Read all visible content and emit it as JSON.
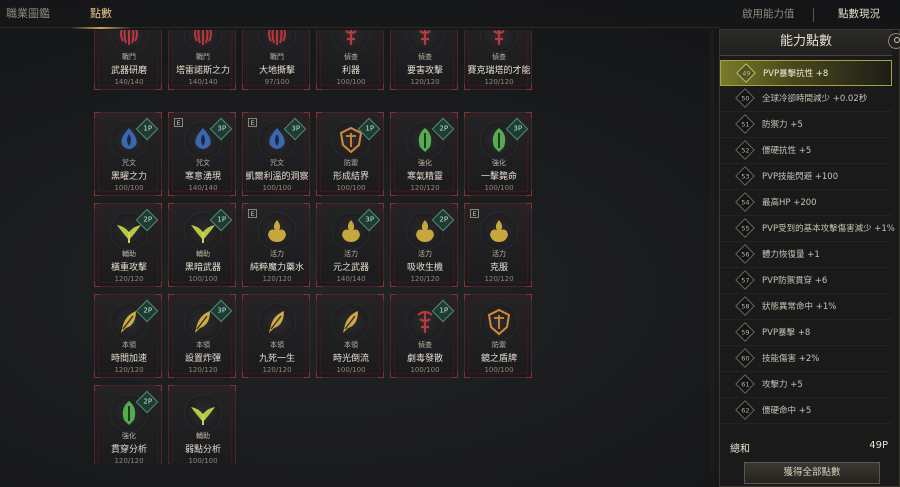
{
  "tabs": {
    "left": [
      "職業圖鑑",
      "點數"
    ],
    "right": [
      "啟用能力值",
      "點數現況"
    ]
  },
  "cards": [
    {
      "cat": "戰鬥",
      "name": "武器研磨",
      "prog": "140/140",
      "icon": "rune-combat-icon",
      "color": "#c0343b",
      "badge": "",
      "e": false
    },
    {
      "cat": "戰鬥",
      "name": "塔雷諾斯之力",
      "prog": "140/140",
      "icon": "rune-combat-icon",
      "color": "#c0343b",
      "badge": "",
      "e": false
    },
    {
      "cat": "戰鬥",
      "name": "大地撕擊",
      "prog": "97/100",
      "icon": "rune-combat-icon",
      "color": "#c0343b",
      "badge": "",
      "e": false
    },
    {
      "cat": "偵查",
      "name": "利器",
      "prog": "100/100",
      "icon": "rune-scout-icon",
      "color": "#b83a3e",
      "badge": "",
      "e": false
    },
    {
      "cat": "偵查",
      "name": "要害攻擊",
      "prog": "120/120",
      "icon": "rune-scout-icon",
      "color": "#b83a3e",
      "badge": "",
      "e": false
    },
    {
      "cat": "偵查",
      "name": "賽克瑞塔的才能",
      "prog": "120/120",
      "icon": "rune-scout-icon",
      "color": "#b83a3e",
      "badge": "",
      "e": false
    },
    {
      "cat": "咒文",
      "name": "黑曜之力",
      "prog": "100/100",
      "icon": "drop-spell-icon",
      "color": "#3f73c8",
      "badge": "1P",
      "e": false
    },
    {
      "cat": "咒文",
      "name": "寒意湧現",
      "prog": "140/140",
      "icon": "drop-spell-icon",
      "color": "#3f73c8",
      "badge": "3P",
      "e": true
    },
    {
      "cat": "咒文",
      "name": "凱爾利溫的洞察",
      "prog": "100/100",
      "icon": "drop-spell-icon",
      "color": "#3f73c8",
      "badge": "3P",
      "e": true
    },
    {
      "cat": "防禦",
      "name": "形成結界",
      "prog": "100/100",
      "icon": "shield-defense-icon",
      "color": "#d3893a",
      "badge": "1P",
      "e": false
    },
    {
      "cat": "強化",
      "name": "寒氣精靈",
      "prog": "120/120",
      "icon": "leaf-enhance-icon",
      "color": "#5fc25a",
      "badge": "2P",
      "e": false
    },
    {
      "cat": "強化",
      "name": "一擊斃命",
      "prog": "100/100",
      "icon": "leaf-enhance-icon",
      "color": "#5fc25a",
      "badge": "3P",
      "e": false
    },
    {
      "cat": "輔助",
      "name": "橫重攻擊",
      "prog": "120/120",
      "icon": "wing-support-icon",
      "color": "#c9d84a",
      "badge": "2P",
      "e": false
    },
    {
      "cat": "輔助",
      "name": "黑暗武器",
      "prog": "100/100",
      "icon": "wing-support-icon",
      "color": "#c9d84a",
      "badge": "1P",
      "e": false
    },
    {
      "cat": "活力",
      "name": "純粹魔力藥水",
      "prog": "120/120",
      "icon": "flame-vitality-icon",
      "color": "#d8b640",
      "badge": "",
      "e": true
    },
    {
      "cat": "活力",
      "name": "元之武器",
      "prog": "140/140",
      "icon": "flame-vitality-icon",
      "color": "#d8b640",
      "badge": "3P",
      "e": false
    },
    {
      "cat": "活力",
      "name": "吸收生機",
      "prog": "120/120",
      "icon": "flame-vitality-icon",
      "color": "#d8b640",
      "badge": "2P",
      "e": false
    },
    {
      "cat": "活力",
      "name": "克服",
      "prog": "120/120",
      "icon": "flame-vitality-icon",
      "color": "#d8b640",
      "badge": "",
      "e": true
    },
    {
      "cat": "本領",
      "name": "時間加速",
      "prog": "120/120",
      "icon": "feather-skill-icon",
      "color": "#e0b94a",
      "badge": "2P",
      "e": false
    },
    {
      "cat": "本領",
      "name": "設置炸彈",
      "prog": "120/120",
      "icon": "feather-skill-icon",
      "color": "#e0b94a",
      "badge": "3P",
      "e": false
    },
    {
      "cat": "本領",
      "name": "九死一生",
      "prog": "120/120",
      "icon": "feather-skill-icon",
      "color": "#e0b94a",
      "badge": "",
      "e": false
    },
    {
      "cat": "本領",
      "name": "時光倒流",
      "prog": "100/100",
      "icon": "feather-skill-icon",
      "color": "#e0b94a",
      "badge": "",
      "e": false
    },
    {
      "cat": "偵查",
      "name": "劇毒發散",
      "prog": "100/100",
      "icon": "rune-scout-icon",
      "color": "#b83a3e",
      "badge": "1P",
      "e": false
    },
    {
      "cat": "防禦",
      "name": "鏡之盾牌",
      "prog": "100/100",
      "icon": "shield-defense-icon",
      "color": "#d3893a",
      "badge": "",
      "e": false
    },
    {
      "cat": "強化",
      "name": "貫穿分析",
      "prog": "120/120",
      "icon": "leaf-enhance-icon",
      "color": "#5fc25a",
      "badge": "2P",
      "e": false
    },
    {
      "cat": "輔助",
      "name": "弱點分析",
      "prog": "100/100",
      "icon": "wing-support-icon",
      "color": "#c9d84a",
      "badge": "",
      "e": false
    }
  ],
  "panel": {
    "title": "能力點數",
    "items": [
      {
        "num": "49",
        "label": "PVP暴擊抗性 +8"
      },
      {
        "num": "50",
        "label": "全球冷卻時間減少 +0.02秒"
      },
      {
        "num": "51",
        "label": "防禦力 +5"
      },
      {
        "num": "52",
        "label": "僵硬抗性 +5"
      },
      {
        "num": "53",
        "label": "PVP技能閃避 +100"
      },
      {
        "num": "54",
        "label": "最高HP +200"
      },
      {
        "num": "55",
        "label": "PVP受到的基本攻擊傷害減少 +1%"
      },
      {
        "num": "56",
        "label": "體力恢復量 +1"
      },
      {
        "num": "57",
        "label": "PVP防禦貫穿 +6"
      },
      {
        "num": "58",
        "label": "狀態異常命中 +1%"
      },
      {
        "num": "59",
        "label": "PVP暴擊 +8"
      },
      {
        "num": "60",
        "label": "技能傷害 +2%"
      },
      {
        "num": "61",
        "label": "攻擊力 +5"
      },
      {
        "num": "62",
        "label": "僵硬命中 +5"
      }
    ],
    "active_index": 0,
    "total_label": "總和",
    "total_value": "49P",
    "button_label": "獲得全部點數"
  }
}
